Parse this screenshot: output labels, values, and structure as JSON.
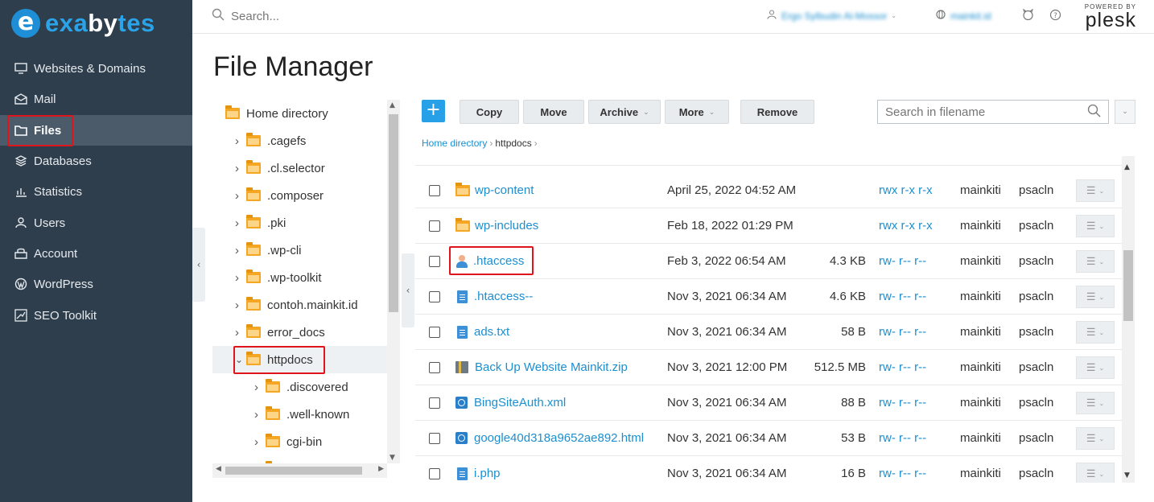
{
  "brand": {
    "part1": "exa",
    "part2": "by",
    "part3": "tes",
    "logo_letter": "e"
  },
  "sidebar": {
    "items": [
      {
        "label": "Websites & Domains",
        "icon": "monitor-icon"
      },
      {
        "label": "Mail",
        "icon": "mail-icon"
      },
      {
        "label": "Files",
        "icon": "folder-icon",
        "active": true
      },
      {
        "label": "Databases",
        "icon": "database-icon"
      },
      {
        "label": "Statistics",
        "icon": "chart-icon"
      },
      {
        "label": "Users",
        "icon": "user-icon"
      },
      {
        "label": "Account",
        "icon": "account-icon"
      },
      {
        "label": "WordPress",
        "icon": "wordpress-icon"
      },
      {
        "label": "SEO Toolkit",
        "icon": "seo-icon"
      }
    ]
  },
  "header": {
    "search_placeholder": "Search...",
    "user_name": "Ergo Sylbudin Al-Mossor",
    "subscription": "mainkit.id",
    "plesk_powered": "POWERED BY",
    "plesk_name": "plesk"
  },
  "page": {
    "title": "File Manager"
  },
  "tree": {
    "root": "Home directory",
    "items": [
      {
        "label": ".cagefs",
        "level": 1,
        "expanded": false
      },
      {
        "label": ".cl.selector",
        "level": 1,
        "expanded": false
      },
      {
        "label": ".composer",
        "level": 1,
        "expanded": false
      },
      {
        "label": ".pki",
        "level": 1,
        "expanded": false
      },
      {
        "label": ".wp-cli",
        "level": 1,
        "expanded": false
      },
      {
        "label": ".wp-toolkit",
        "level": 1,
        "expanded": false
      },
      {
        "label": "contoh.mainkit.id",
        "level": 1,
        "expanded": false
      },
      {
        "label": "error_docs",
        "level": 1,
        "expanded": false
      },
      {
        "label": "httpdocs",
        "level": 1,
        "expanded": true
      },
      {
        "label": ".discovered",
        "level": 2,
        "expanded": false
      },
      {
        "label": ".well-known",
        "level": 2,
        "expanded": false
      },
      {
        "label": "cgi-bin",
        "level": 2,
        "expanded": false
      }
    ]
  },
  "toolbar": {
    "add_label": "+",
    "copy": "Copy",
    "move": "Move",
    "archive": "Archive",
    "more": "More",
    "remove": "Remove",
    "search_placeholder": "Search in filename"
  },
  "breadcrumb": {
    "root": "Home directory",
    "current": "httpdocs"
  },
  "files": [
    {
      "name": "wp-content",
      "type": "folder",
      "date": "April 25, 2022 04:52 AM",
      "size": "",
      "perm": "rwx r-x r-x",
      "user": "mainkiti",
      "group": "psacln"
    },
    {
      "name": "wp-includes",
      "type": "folder",
      "date": "Feb 18, 2022 01:29 PM",
      "size": "",
      "perm": "rwx r-x r-x",
      "user": "mainkiti",
      "group": "psacln"
    },
    {
      "name": ".htaccess",
      "type": "user",
      "date": "Feb 3, 2022 06:54 AM",
      "size": "4.3 KB",
      "perm": "rw- r-- r--",
      "user": "mainkiti",
      "group": "psacln"
    },
    {
      "name": ".htaccess--",
      "type": "doc",
      "date": "Nov 3, 2021 06:34 AM",
      "size": "4.6 KB",
      "perm": "rw- r-- r--",
      "user": "mainkiti",
      "group": "psacln"
    },
    {
      "name": "ads.txt",
      "type": "doc",
      "date": "Nov 3, 2021 06:34 AM",
      "size": "58 B",
      "perm": "rw- r-- r--",
      "user": "mainkiti",
      "group": "psacln"
    },
    {
      "name": "Back Up Website Mainkit.zip",
      "type": "zip",
      "date": "Nov 3, 2021 12:00 PM",
      "size": "512.5 MB",
      "perm": "rw- r-- r--",
      "user": "mainkiti",
      "group": "psacln"
    },
    {
      "name": "BingSiteAuth.xml",
      "type": "web",
      "date": "Nov 3, 2021 06:34 AM",
      "size": "88 B",
      "perm": "rw- r-- r--",
      "user": "mainkiti",
      "group": "psacln"
    },
    {
      "name": "google40d318a9652ae892.html",
      "type": "web",
      "date": "Nov 3, 2021 06:34 AM",
      "size": "53 B",
      "perm": "rw- r-- r--",
      "user": "mainkiti",
      "group": "psacln"
    },
    {
      "name": "i.php",
      "type": "doc",
      "date": "Nov 3, 2021 06:34 AM",
      "size": "16 B",
      "perm": "rw- r-- r--",
      "user": "mainkiti",
      "group": "psacln"
    }
  ],
  "colors": {
    "sidebar_bg": "#2f3e4c",
    "accent": "#1c8fd0",
    "highlight": "#e0141b",
    "folder": "#f5a623"
  }
}
